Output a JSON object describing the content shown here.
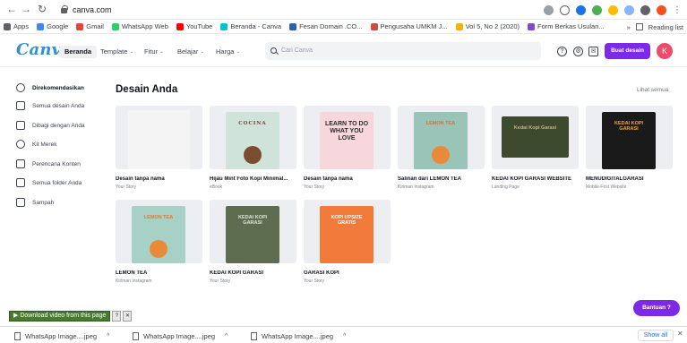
{
  "browser": {
    "url": "canva.com",
    "bookmarks": [
      {
        "label": "Apps",
        "color": "#5f6368"
      },
      {
        "label": "Google",
        "color": "#4285f4"
      },
      {
        "label": "Gmail",
        "color": "#ea4335"
      },
      {
        "label": "WhatsApp Web",
        "color": "#25d366"
      },
      {
        "label": "YouTube",
        "color": "#ff0000"
      },
      {
        "label": "Beranda - Canva",
        "color": "#00c4cc"
      },
      {
        "label": "Fesan Domain .CO...",
        "color": "#2b5fb3"
      },
      {
        "label": "Pengusaha UMKM J...",
        "color": "#d5483c"
      },
      {
        "label": "Vol 5, No 2 (2020)",
        "color": "#f4b400"
      },
      {
        "label": "Form Berkas Usulan...",
        "color": "#7d4bd0"
      }
    ],
    "bookmarks_more": "»",
    "reading_list": "Reading list"
  },
  "header": {
    "logo": "Canva",
    "menu": [
      "Beranda",
      "Template",
      "Fitur",
      "Belajar",
      "Harga"
    ],
    "search_placeholder": "Cari Canva",
    "create_button": "Buat desain",
    "avatar_initial": "K"
  },
  "sidebar": {
    "items": [
      {
        "label": "Direkomendasikan",
        "icon": "home-icon"
      },
      {
        "label": "Semua desain Anda",
        "icon": "grid-icon"
      },
      {
        "label": "Dibagi dengan Anda",
        "icon": "users-icon"
      },
      {
        "label": "Kit Merek",
        "icon": "brand-icon"
      },
      {
        "label": "Perencana Konten",
        "icon": "calendar-icon"
      },
      {
        "label": "Semua folder Anda",
        "icon": "folder-icon"
      },
      {
        "label": "Sampah",
        "icon": "trash-icon"
      }
    ]
  },
  "main": {
    "title": "Desain Anda",
    "see_all": "Lihat semua",
    "cards": [
      {
        "title": "Desain tanpa nama",
        "subtitle": "Your Story",
        "thumb_text": "",
        "bg": "#f4f4f5",
        "fg": "#e2e3e6"
      },
      {
        "title": "Hijau Mint Foto Kopi Minimal...",
        "subtitle": "eBook",
        "thumb_text": "COCINA",
        "bg": "#cfe3da",
        "fg": "#6b4a32"
      },
      {
        "title": "Desain tanpa nama",
        "subtitle": "Your Story",
        "thumb_text": "LEARN TO DO WHAT YOU LOVE",
        "bg": "#f7d7dc",
        "fg": "#2b2b2b"
      },
      {
        "title": "Salinan dari LEMON TEA",
        "subtitle": "Kiriman Instagram",
        "thumb_text": "LEMON TEA",
        "bg": "#9ac4b8",
        "fg": "#d9742a"
      },
      {
        "title": "KEDAI KOPI GARASI WEBSITE",
        "subtitle": "Landing Page",
        "thumb_text": "Kedai Kopi Garasi",
        "bg": "#3d4a2e",
        "fg": "#c7b48a"
      },
      {
        "title": "MENUDIGITALGARASI",
        "subtitle": "Mobile-First Website",
        "thumb_text": "KEDAI KOPI GARASI",
        "bg": "#1a1a1a",
        "fg": "#f5a623"
      },
      {
        "title": "LEMON TEA",
        "subtitle": "Kiriman Instagram",
        "thumb_text": "LEMON TEA",
        "bg": "#a7d1c4",
        "fg": "#e07b2e"
      },
      {
        "title": "KEDAI KOPI GARASI",
        "subtitle": "Your Story",
        "thumb_text": "KEDAI KOPI GARASI",
        "bg": "#5e6d50",
        "fg": "#dfe4d2"
      },
      {
        "title": "GARASI KOPI",
        "subtitle": "Your Story",
        "thumb_text": "KOPI UPSIZE GRATIS",
        "bg": "#f27a3a",
        "fg": "#ffffff"
      }
    ]
  },
  "download_ext": {
    "label": "▶ Download video from this page",
    "btn1": "?",
    "btn2": "✕"
  },
  "help_button": "Bantuan  ?",
  "downloads": {
    "items": [
      "WhatsApp Image....jpeg",
      "WhatsApp Image....jpeg",
      "WhatsApp Image....jpeg"
    ],
    "show_all": "Show all",
    "close": "✕"
  },
  "colors": {
    "accent": "#7d2ae8",
    "logo": "#3a8ec8"
  }
}
